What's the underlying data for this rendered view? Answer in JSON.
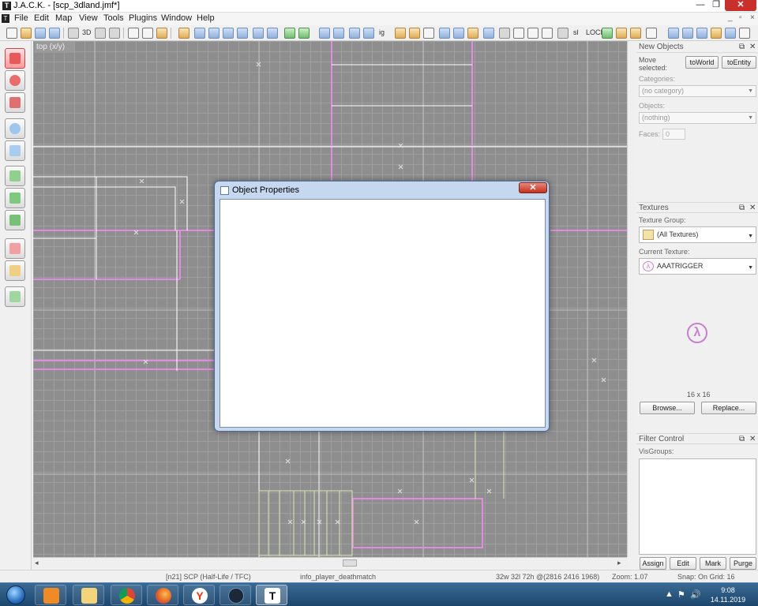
{
  "window": {
    "title": "J.A.C.K. - [scp_3dland.jmf*]",
    "app_icon": "jack-app-icon",
    "minimize_label": "—",
    "maximize_label": "❐",
    "close_label": "✕"
  },
  "menu": {
    "items": [
      "File",
      "Edit",
      "Map",
      "View",
      "Tools",
      "Plugins",
      "Window",
      "Help"
    ]
  },
  "toolbar": {
    "text_buttons": [
      "3D",
      "ig",
      "sl",
      "LOCK"
    ]
  },
  "viewport": {
    "label": "top (x/y)"
  },
  "dialog": {
    "title": "Object Properties",
    "close_label": "✕"
  },
  "new_objects": {
    "header": "New Objects",
    "move_label": "Move\nselected:",
    "to_world": "toWorld",
    "to_entity": "toEntity",
    "categories_label": "Categories:",
    "categories_value": "(no category)",
    "objects_label": "Objects:",
    "objects_value": "(nothing)",
    "faces_label": "Faces:",
    "faces_value": "0"
  },
  "textures": {
    "header": "Textures",
    "group_label": "Texture Group:",
    "group_value": "(All Textures)",
    "current_label": "Current Texture:",
    "current_value": "AAATRIGGER",
    "preview_symbol": "λ",
    "size": "16 x 16",
    "browse": "Browse...",
    "replace": "Replace..."
  },
  "filter_control": {
    "header": "Filter Control",
    "visgroups_label": "VisGroups:",
    "assign": "Assign",
    "edit": "Edit",
    "mark": "Mark",
    "purge": "Purge"
  },
  "statusbar": {
    "game": "[n21] SCP (Half-Life / TFC)",
    "entity": "info_player_deathmatch",
    "coords": "32w 32l 72h @(2816 2416 1968)",
    "zoom": "Zoom: 1.07",
    "snap": "Snap: On Grid: 16"
  },
  "taskbar": {
    "time": "9:08",
    "date": "14.11.2019",
    "tray_icons": [
      "▲",
      "⚑",
      "🔊"
    ]
  },
  "colors": {
    "viewport_bg": "#8e8e8e",
    "brush_magenta": "#e08ce0",
    "brush_white": "#ffffff",
    "selected_tool": "#ff9a9a"
  }
}
